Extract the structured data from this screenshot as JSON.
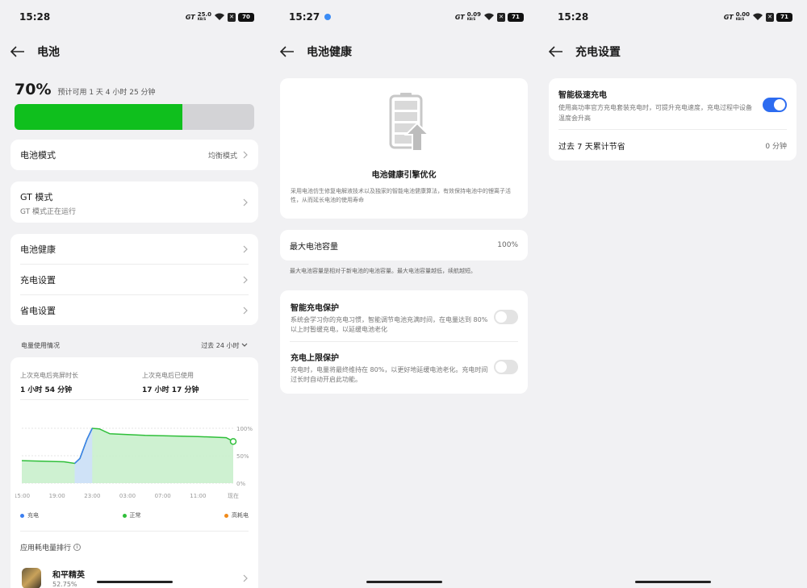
{
  "panel1": {
    "status": {
      "time": "15:28",
      "gt": "GT",
      "speed": "25.0",
      "speed_unit": "KB/S",
      "battery": "70"
    },
    "title": "电池",
    "percent": "70%",
    "estimate": "预计可用 1 天 4 小时 25 分钟",
    "battery_level": 0.7,
    "mode": {
      "label": "电池模式",
      "value": "均衡模式"
    },
    "gt_mode": {
      "label": "GT 模式",
      "desc": "GT 模式正在运行"
    },
    "menu": [
      "电池健康",
      "充电设置",
      "省电设置"
    ],
    "usage": {
      "title": "电量使用情况",
      "range": "过去 24 小时",
      "stat1_label": "上次充电后亮屏时长",
      "stat1_value": "1 小时 54 分钟",
      "stat2_label": "上次充电后已使用",
      "stat2_value": "17 小时 17 分钟",
      "legend": [
        "充电",
        "正常",
        "高耗电"
      ],
      "ranking_title": "应用耗电量排行",
      "app_name": "和平精英",
      "app_percent": "52.75%"
    }
  },
  "panel2": {
    "status": {
      "time": "15:27",
      "gt": "GT",
      "speed": "0.09",
      "speed_unit": "KB/S",
      "battery": "71"
    },
    "title": "电池健康",
    "engine_title": "电池健康引擎优化",
    "engine_desc": "采用电池仿生修复电解液技术以及独家的智能电池健康算法，有效保持电池中的锂离子活性，从而延长电池的使用寿命",
    "capacity_label": "最大电池容量",
    "capacity_value": "100%",
    "capacity_note": "最大电池容量是相对于新电池的电池容量。最大电池容量越低，续航越短。",
    "smart_title": "智能充电保护",
    "smart_desc": "系统会学习你的充电习惯，智能调节电池充满时间，在电量达到 80% 以上时暂缓充电，以延缓电池老化",
    "limit_title": "充电上限保护",
    "limit_desc": "充电时，电量将最终维持在 80%，以更好地延缓电池老化。充电时间过长时自动开启此功能。"
  },
  "panel3": {
    "status": {
      "time": "15:28",
      "gt": "GT",
      "speed": "0.00",
      "speed_unit": "KB/S",
      "battery": "71"
    },
    "title": "充电设置",
    "fast_title": "智能极速充电",
    "fast_desc": "使用高功率官方充电套装充电时，可提升充电速度，充电过程中设备温度会升高",
    "saved_label": "过去 7 天累计节省",
    "saved_value": "0 分钟"
  },
  "chart_data": {
    "type": "area",
    "x": [
      "15:00",
      "19:00",
      "23:00",
      "03:00",
      "07:00",
      "11:00",
      "现在"
    ],
    "y_ticks": [
      "100%",
      "50%",
      "0%"
    ],
    "ylim": [
      0,
      100
    ],
    "series": [
      {
        "name": "正常",
        "points": [
          [
            0,
            41
          ],
          [
            1.2,
            39
          ],
          [
            1.5,
            36
          ],
          [
            1.65,
            45
          ],
          [
            1.85,
            80
          ],
          [
            2.0,
            100
          ],
          [
            2.2,
            99
          ],
          [
            2.5,
            90
          ],
          [
            3.5,
            87
          ],
          [
            5,
            85
          ],
          [
            5.8,
            83
          ],
          [
            6.0,
            76
          ]
        ]
      }
    ],
    "colors": {
      "line": "#2fbf3a",
      "fill": "#c9f0cc",
      "charge": "#3b7ef0"
    }
  }
}
